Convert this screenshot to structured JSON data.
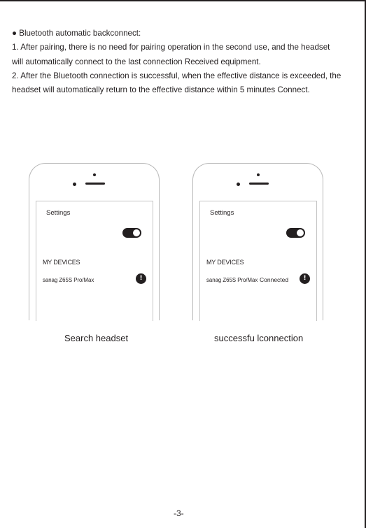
{
  "document": {
    "heading": "● Bluetooth automatic backconnect:",
    "lines": [
      "1. After pairing, there is no need for pairing operation in the second use, and the headset",
      "will automatically connect to the last connection Received equipment.",
      "2. After the Bluetooth connection is successful, when the effective distance is exceeded, the",
      "headset will automatically return to the effective distance within 5 minutes Connect."
    ],
    "page_number": "-3-"
  },
  "figures": [
    {
      "settings_title": "Settings",
      "devices_header": "MY DEVICES",
      "device_name": "sanag Z65S Pro/Max",
      "device_status": "",
      "info_icon": "info-icon",
      "caption": "Search headset"
    },
    {
      "settings_title": "Settings",
      "devices_header": "MY DEVICES",
      "device_name": "sanag Z65S Pro/Max",
      "device_status": "Connected",
      "info_icon": "info-icon",
      "caption": "successfu lconnection"
    }
  ],
  "colors": {
    "ink": "#231f20",
    "phone_outline": "#b7b7b7",
    "background": "#ffffff"
  }
}
